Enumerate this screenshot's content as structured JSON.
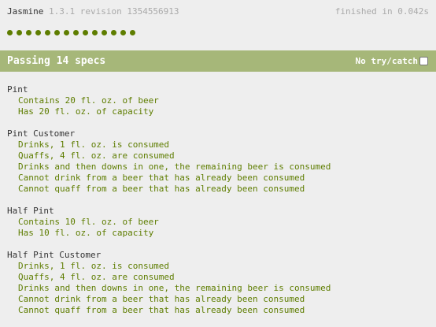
{
  "banner": {
    "title": "Jasmine",
    "version": "1.3.1 revision 1354556913",
    "duration": "finished in 0.042s"
  },
  "symbols": {
    "count": 14,
    "status": "passed",
    "color": "#5e7d00"
  },
  "bar": {
    "label": "Passing 14 specs",
    "try_catch_label": "No try/catch",
    "try_catch_checked": false,
    "color": "#a6b779"
  },
  "suites": [
    {
      "name": "Pint",
      "specs": [
        "Contains 20 fl. oz. of beer",
        "Has 20 fl. oz. of capacity"
      ]
    },
    {
      "name": "Pint Customer",
      "specs": [
        "Drinks, 1 fl. oz. is consumed",
        "Quaffs, 4 fl. oz. are consumed",
        "Drinks and then downs in one, the remaining beer is consumed",
        "Cannot drink from a beer that has already been consumed",
        "Cannot quaff from a beer that has already been consumed"
      ]
    },
    {
      "name": "Half Pint",
      "specs": [
        "Contains 10 fl. oz. of beer",
        "Has 10 fl. oz. of capacity"
      ]
    },
    {
      "name": "Half Pint Customer",
      "specs": [
        "Drinks, 1 fl. oz. is consumed",
        "Quaffs, 4 fl. oz. are consumed",
        "Drinks and then downs in one, the remaining beer is consumed",
        "Cannot drink from a beer that has already been consumed",
        "Cannot quaff from a beer that has already been consumed"
      ]
    }
  ]
}
